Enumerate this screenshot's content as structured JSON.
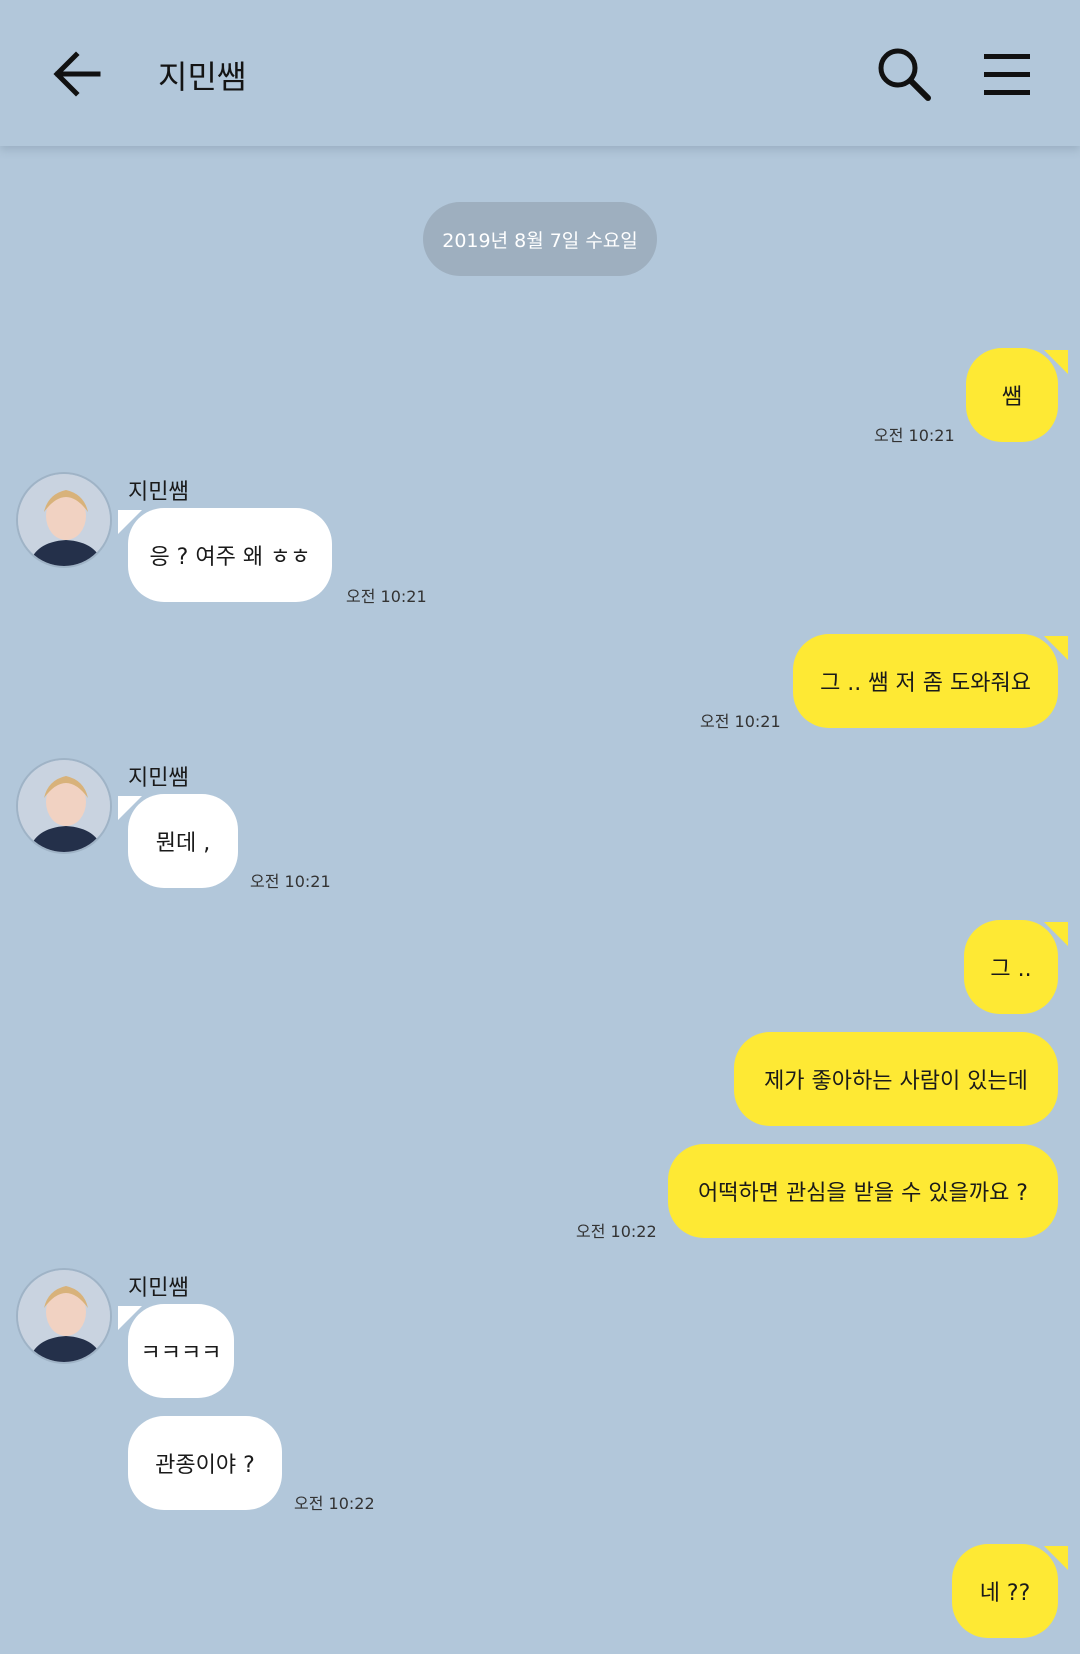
{
  "header": {
    "title": "지민쌤",
    "back_icon": "arrow-left-icon",
    "search_icon": "search-icon",
    "menu_icon": "menu-icon"
  },
  "date_divider": "2019년 8월 7일 수요일",
  "sender_name": "지민쌤",
  "colors": {
    "background": "#b2c7da",
    "mine_bubble": "#fee934",
    "their_bubble": "#ffffff",
    "date_pill": "#9eafbf"
  },
  "messages": [
    {
      "text": "쌤",
      "time": "오전 10:21",
      "from": "me"
    },
    {
      "text": "응 ? 여주 왜 ㅎㅎ",
      "time": "오전 10:21",
      "from": "them"
    },
    {
      "text": "그 .. 쌤 저 좀 도와줘요",
      "time": "오전 10:21",
      "from": "me"
    },
    {
      "text": "뭔데 ,",
      "time": "오전 10:21",
      "from": "them"
    },
    {
      "text": "그 ..",
      "from": "me"
    },
    {
      "text": "제가 좋아하는 사람이 있는데",
      "from": "me"
    },
    {
      "text": "어떡하면 관심을 받을 수 있을까요 ?",
      "time": "오전 10:22",
      "from": "me"
    },
    {
      "text": "ㅋㅋㅋㅋ",
      "from": "them"
    },
    {
      "text": "관종이야 ?",
      "time": "오전 10:22",
      "from": "them"
    },
    {
      "text": "네 ??",
      "from": "me"
    }
  ]
}
